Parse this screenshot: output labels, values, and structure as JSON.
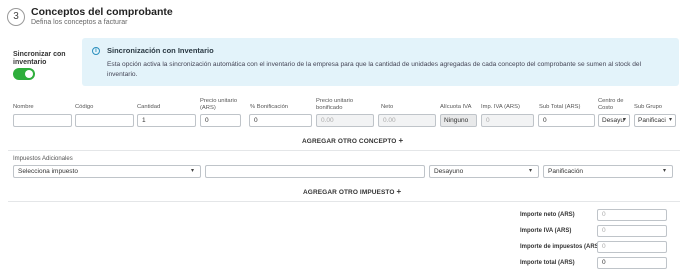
{
  "header": {
    "step": "3",
    "title": "Conceptos del comprobante",
    "subtitle": "Defina los conceptos a facturar"
  },
  "sync": {
    "label": "Sincronizar con inventario",
    "enabled": true
  },
  "info": {
    "title": "Sincronización con Inventario",
    "text": "Esta opción activa la sincronización automática con el inventario de la empresa para que la cantidad de unidades agregadas de cada concepto del comprobante se sumen al stock del inventario."
  },
  "columns": {
    "nombre": "Nombre",
    "codigo": "Código",
    "cantidad": "Cantidad",
    "precio_unitario": "Precio unitario (ARS)",
    "bonificacion": "% Bonificación",
    "precio_bonificado": "Precio unitario bonificado",
    "neto": "Neto",
    "alicuota": "Alícuota IVA",
    "imp_iva": "Imp. IVA (ARS)",
    "subtotal": "Sub Total (ARS)",
    "centro_costo": "Centro de Costo",
    "sub_grupo": "Sub Grupo"
  },
  "concept_row": {
    "nombre": "",
    "codigo": "",
    "cantidad": "1",
    "precio_unitario": "0",
    "bonificacion": "0",
    "precio_bonificado": "0.00",
    "neto": "0.00",
    "alicuota": "Ninguno",
    "imp_iva": "0",
    "subtotal": "0",
    "centro_costo": "Desayu",
    "sub_grupo": "Panificaci"
  },
  "add_concept": "AGREGAR OTRO CONCEPTO",
  "taxes": {
    "label": "Impuestos Adicionales",
    "select_placeholder": "Selecciona impuesto",
    "amount": "",
    "centro_costo": "Desayuno",
    "sub_grupo": "Panificación"
  },
  "add_tax": "AGREGAR OTRO IMPUESTO",
  "totals": [
    {
      "label": "Importe neto (ARS)",
      "value": "0",
      "placeholder": true
    },
    {
      "label": "Importe IVA (ARS)",
      "value": "0",
      "placeholder": true
    },
    {
      "label": "Importe de impuestos (ARS)",
      "value": "0",
      "placeholder": true
    },
    {
      "label": "Importe total (ARS)",
      "value": "0",
      "placeholder": false
    }
  ],
  "colors": {
    "accent": "#2fae3c",
    "info_bg": "#e3f3fa",
    "info_icon": "#2a8fbd"
  }
}
